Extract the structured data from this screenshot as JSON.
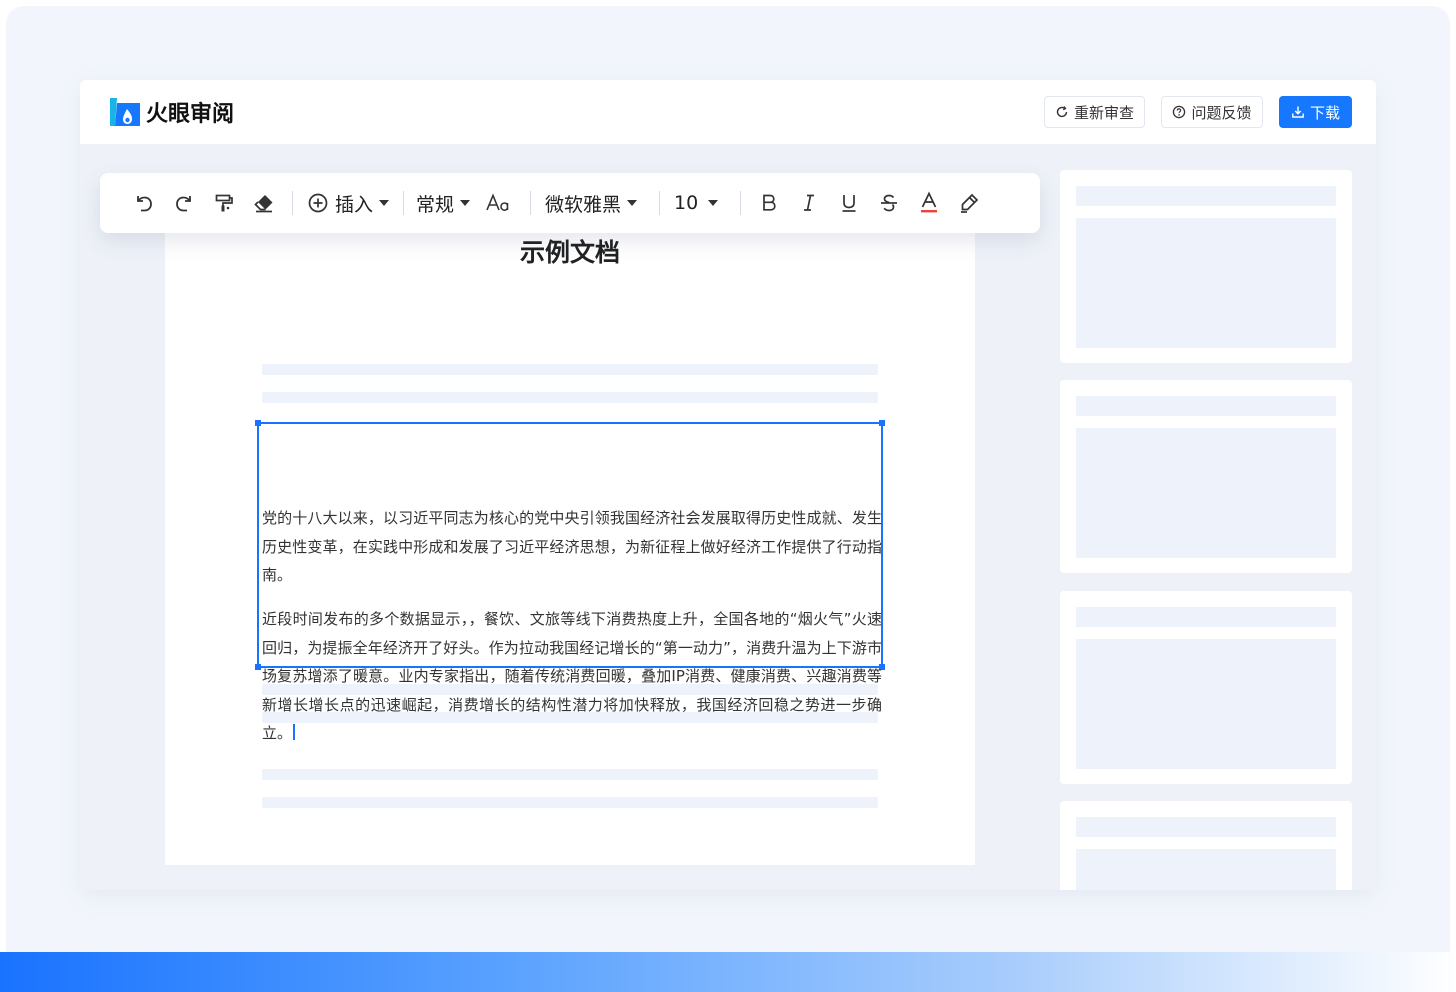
{
  "app": {
    "logo_text": "火眼审阅"
  },
  "header": {
    "recheck_label": "重新审查",
    "feedback_label": "问题反馈",
    "download_label": "下载"
  },
  "toolbar": {
    "insert_label": "插入",
    "style_label": "常规",
    "font_family": "微软雅黑",
    "font_size": "10"
  },
  "document": {
    "title": "示例文档",
    "paragraphs": [
      "党的十八大以来，以习近平同志为核心的党中央引领我国经济社会发展取得历史性成就、发生历史性变革，在实践中形成和发展了习近平经济思想，为新征程上做好经济工作提供了行动指南。",
      "近段时间发布的多个数据显示，，餐饮、文旅等线下消费热度上升，全国各地的“烟火气”火速回归，为提振全年经济开了好头。作为拉动我国经记增长的“第一动力”，消费升温为上下游市场复苏增添了暖意。业内专家指出，随着传统消费回暖，叠加IP消费、健康消费、兴趣消费等新增长增长点的迅速崛起，消费增长的结构性潜力将加快释放，我国经济回稳之势进一步确立。"
    ]
  },
  "colors": {
    "accent": "#1677ff",
    "font_color_underline": "#e8453c"
  },
  "icons": {
    "undo": "undo-icon",
    "redo": "redo-icon",
    "format_painter": "format-painter-icon",
    "eraser": "eraser-icon",
    "insert": "plus-circle-icon",
    "text_size": "text-size-icon",
    "bold": "bold-icon",
    "italic": "italic-icon",
    "underline": "underline-icon",
    "strikethrough": "strikethrough-icon",
    "font_color": "font-color-icon",
    "highlight": "highlighter-icon"
  }
}
